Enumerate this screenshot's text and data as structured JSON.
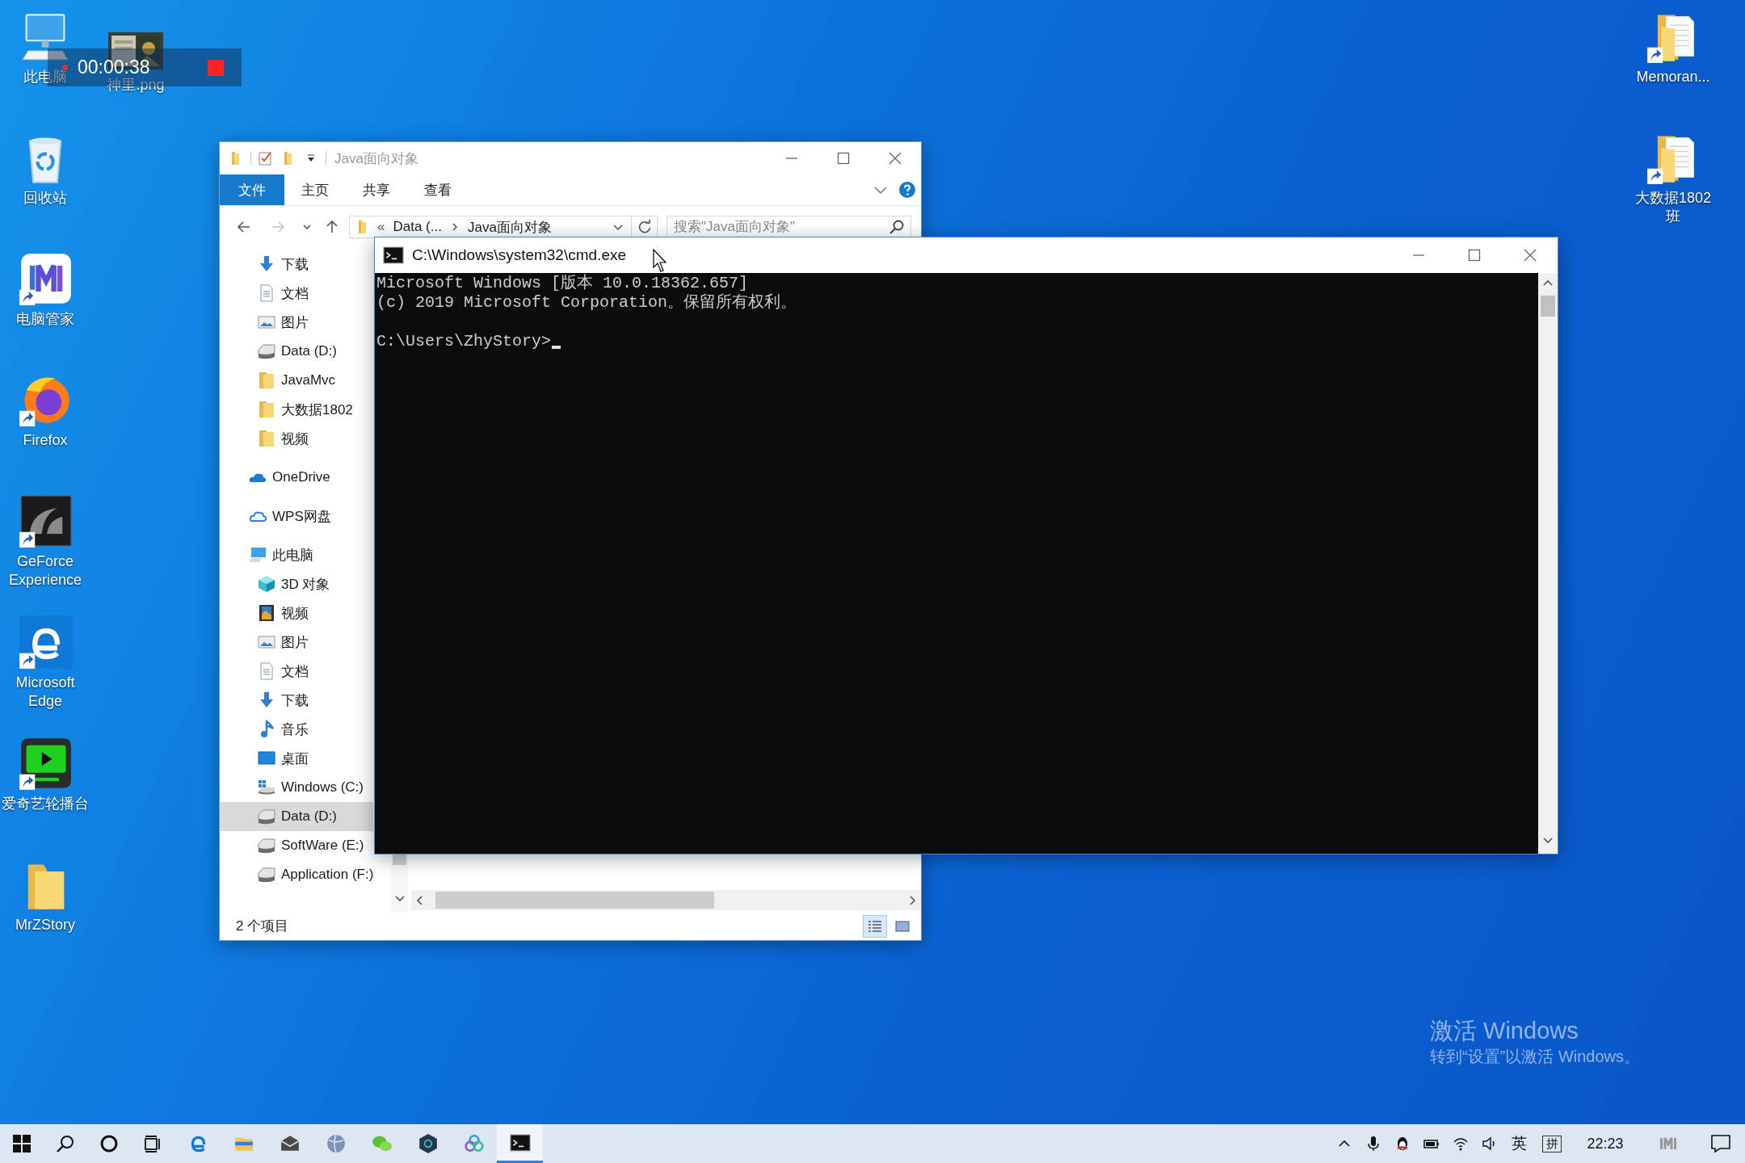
{
  "desktop_icons_left": [
    {
      "label": "此电脑",
      "kind": "computer",
      "shortcut": false
    },
    {
      "label": "回收站",
      "kind": "recycle-bin",
      "shortcut": false
    },
    {
      "label": "电脑管家",
      "kind": "pc-manager",
      "shortcut": true
    },
    {
      "label": "Firefox",
      "kind": "firefox",
      "shortcut": true
    },
    {
      "label": "GeForce Experience",
      "kind": "geforce",
      "shortcut": true
    },
    {
      "label": "Microsoft Edge",
      "kind": "edge",
      "shortcut": true
    },
    {
      "label": "爱奇艺轮播台",
      "kind": "player",
      "shortcut": true
    },
    {
      "label": "MrZStory",
      "kind": "folder",
      "shortcut": false
    }
  ],
  "desktop_file": {
    "label": "神里.png",
    "kind": "picture"
  },
  "desktop_icons_right": [
    {
      "label": "Memoran...",
      "kind": "document-folder",
      "shortcut": true
    },
    {
      "label": "大数据1802班",
      "kind": "document-folder",
      "shortcut": true
    }
  ],
  "recorder": {
    "time": "00:00:38",
    "recording": true
  },
  "explorer": {
    "title": "Java面向对象",
    "ribbon_tabs": [
      {
        "label": "文件",
        "selected": true
      },
      {
        "label": "主页",
        "selected": false
      },
      {
        "label": "共享",
        "selected": false
      },
      {
        "label": "查看",
        "selected": false
      }
    ],
    "address": {
      "overflow": "«",
      "crumbs": [
        "Data (...",
        "Java面向对象"
      ]
    },
    "search": {
      "placeholder": "搜索\"Java面向对象\""
    },
    "quick_access_items": [
      {
        "label": "下载",
        "kind": "download",
        "selected": false
      },
      {
        "label": "文档",
        "kind": "document",
        "selected": false
      },
      {
        "label": "图片",
        "kind": "pictures",
        "selected": false
      },
      {
        "label": "Data (D:)",
        "kind": "drive",
        "selected": false
      },
      {
        "label": "JavaMvc",
        "kind": "folder",
        "selected": false
      },
      {
        "label": "大数据1802",
        "kind": "folder",
        "selected": false
      },
      {
        "label": "视频",
        "kind": "folder",
        "selected": false
      }
    ],
    "nav_roots": [
      {
        "label": "OneDrive",
        "kind": "onedrive",
        "selected": false
      },
      {
        "label": "WPS网盘",
        "kind": "cloud",
        "selected": false
      },
      {
        "label": "此电脑",
        "kind": "computer",
        "selected": false,
        "children": [
          {
            "label": "3D 对象",
            "kind": "cube",
            "selected": false
          },
          {
            "label": "视频",
            "kind": "video",
            "selected": false
          },
          {
            "label": "图片",
            "kind": "pictures",
            "selected": false
          },
          {
            "label": "文档",
            "kind": "document",
            "selected": false
          },
          {
            "label": "下载",
            "kind": "download",
            "selected": false
          },
          {
            "label": "音乐",
            "kind": "music",
            "selected": false
          },
          {
            "label": "桌面",
            "kind": "desktop",
            "selected": false
          },
          {
            "label": "Windows (C:)",
            "kind": "windows-drive",
            "selected": false
          },
          {
            "label": "Data (D:)",
            "kind": "drive",
            "selected": true
          },
          {
            "label": "SoftWare (E:)",
            "kind": "drive",
            "selected": false
          },
          {
            "label": "Application (F:)",
            "kind": "drive",
            "selected": false
          }
        ]
      }
    ],
    "status": "2 个项目",
    "views": [
      {
        "kind": "details",
        "selected": true
      },
      {
        "kind": "tiles",
        "selected": false
      }
    ]
  },
  "cmd": {
    "title": "C:\\Windows\\system32\\cmd.exe",
    "lines": [
      "Microsoft Windows [版本 10.0.18362.657]",
      "(c) 2019 Microsoft Corporation。保留所有权利。"
    ],
    "prompt": "C:\\Users\\ZhyStory>"
  },
  "taskbar": {
    "apps": [
      {
        "kind": "edge",
        "selected": false
      },
      {
        "kind": "explorer",
        "selected": false
      },
      {
        "kind": "mail",
        "selected": false
      },
      {
        "kind": "globe",
        "selected": false
      },
      {
        "kind": "chat",
        "selected": false
      },
      {
        "kind": "hexagon",
        "selected": false
      },
      {
        "kind": "rings",
        "selected": false
      },
      {
        "kind": "cmd",
        "selected": true
      }
    ],
    "language": "英",
    "input_mode": "拼",
    "time": "22:23"
  },
  "activation": {
    "title": "激活 Windows",
    "text": "转到“设置”以激活 Windows。"
  }
}
